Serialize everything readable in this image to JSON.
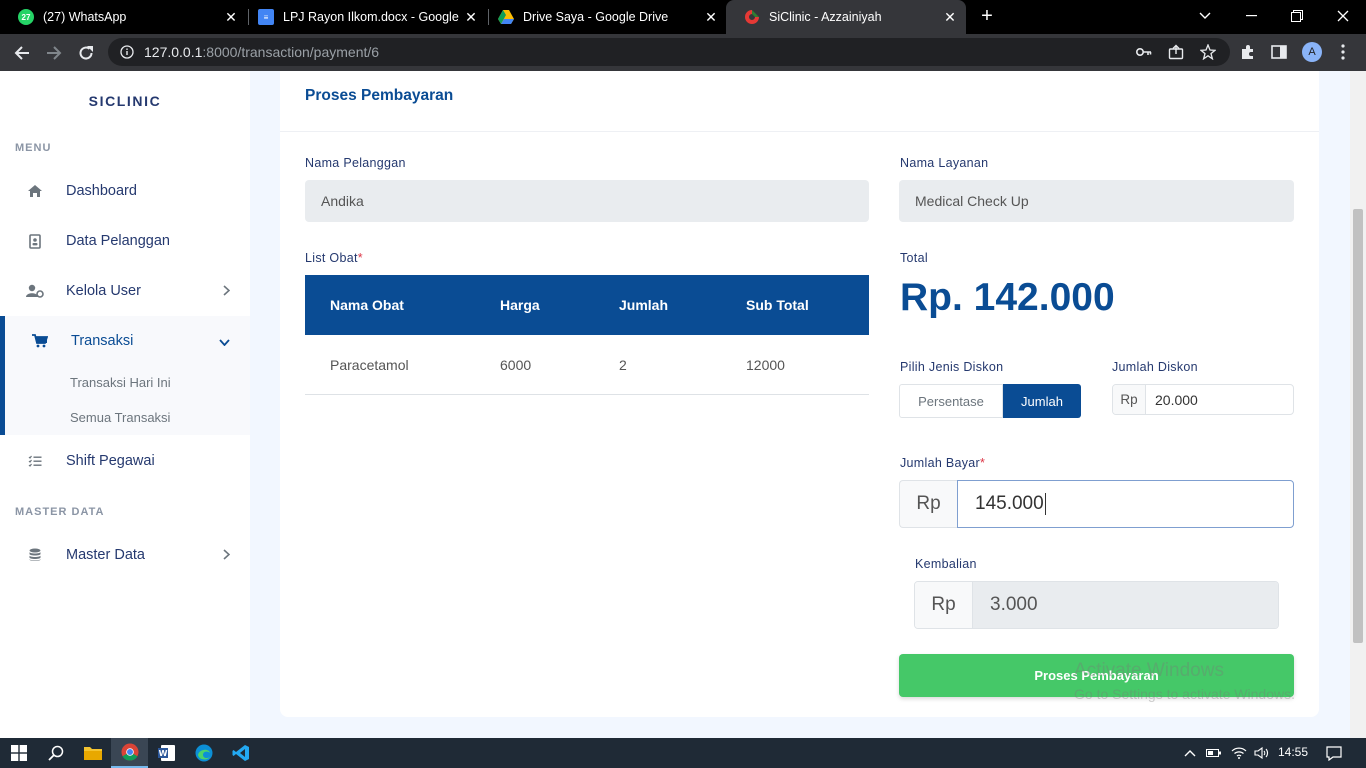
{
  "browser": {
    "tabs": [
      {
        "title": "(27) WhatsApp",
        "icon": "whatsapp-icon",
        "color": "#25d366"
      },
      {
        "title": "LPJ Rayon Ilkom.docx - Google D",
        "icon": "google-docs-icon",
        "color": "#4285f4"
      },
      {
        "title": "Drive Saya - Google Drive",
        "icon": "google-drive-icon",
        "color": "#fbbc04"
      },
      {
        "title": "SiClinic - Azzainiyah",
        "icon": "siclinic-favicon",
        "color": "#e53935"
      }
    ],
    "whatsapp_badge": "27",
    "url_host": "127.0.0.1",
    "url_path": ":8000/transaction/payment/6",
    "profile_initial": "A"
  },
  "sidebar": {
    "brand": "SICLINIC",
    "menu_label": "MENU",
    "master_label": "MASTER DATA",
    "items": [
      {
        "label": "Dashboard",
        "icon": "home-icon"
      },
      {
        "label": "Data Pelanggan",
        "icon": "contact-card-icon"
      },
      {
        "label": "Kelola User",
        "icon": "user-gear-icon"
      },
      {
        "label": "Transaksi",
        "icon": "cart-icon"
      },
      {
        "label": "Shift Pegawai",
        "icon": "list-check-icon"
      },
      {
        "label": "Master Data",
        "icon": "database-icon"
      }
    ],
    "subitems": [
      "Transaksi Hari Ini",
      "Semua Transaksi"
    ]
  },
  "card": {
    "title": "Proses Pembayaran",
    "customer_label": "Nama Pelanggan",
    "customer_value": "Andika",
    "service_label": "Nama Layanan",
    "service_value": "Medical Check Up",
    "list_label": "List Obat",
    "required_mark": "*",
    "table": {
      "headers": [
        "Nama Obat",
        "Harga",
        "Jumlah",
        "Sub Total"
      ],
      "rows": [
        [
          "Paracetamol",
          "6000",
          "2",
          "12000"
        ]
      ]
    },
    "total_label": "Total",
    "total_value": "Rp. 142.000",
    "discount_type_label": "Pilih Jenis Diskon",
    "discount_options": [
      "Persentase",
      "Jumlah"
    ],
    "discount_selected": "Jumlah",
    "discount_amount_label": "Jumlah Diskon",
    "currency_prefix": "Rp",
    "discount_amount_value": "20.000",
    "pay_label": "Jumlah Bayar",
    "pay_value": "145.000",
    "change_label": "Kembalian",
    "change_value": "3.000",
    "submit_label": "Proses Pembayaran"
  },
  "watermark": {
    "line1": "Activate Windows",
    "line2": "Go to Settings to activate Windows."
  },
  "taskbar": {
    "time": "14:55"
  },
  "colors": {
    "primary": "#0a4c94",
    "success": "#45c868",
    "required": "#dc3545"
  }
}
